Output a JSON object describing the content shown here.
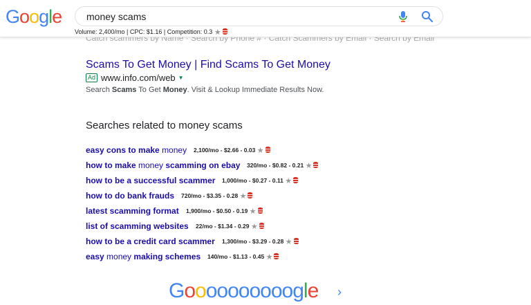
{
  "logo": {
    "letters": [
      {
        "ch": "G",
        "color": "#4285f4"
      },
      {
        "ch": "o",
        "color": "#ea4335"
      },
      {
        "ch": "o",
        "color": "#fbbc05"
      },
      {
        "ch": "g",
        "color": "#4285f4"
      },
      {
        "ch": "l",
        "color": "#34a853"
      },
      {
        "ch": "e",
        "color": "#ea4335"
      }
    ]
  },
  "search": {
    "query": "money scams"
  },
  "keyword_bar": {
    "text": "Volume: 2,400/mo | CPC: $1.16 | Competition: 0.3"
  },
  "cutoff_text": "Catch scammers by Name · Search by Phone # · Catch Scammers by Email · Search by Email",
  "ad": {
    "title": "Scams To Get Money | Find Scams To Get Money",
    "badge": "Ad",
    "url": "www.info.com/web",
    "desc_parts": [
      {
        "t": "Search ",
        "b": false
      },
      {
        "t": "Scams",
        "b": true
      },
      {
        "t": " To Get ",
        "b": false
      },
      {
        "t": "Money",
        "b": true
      },
      {
        "t": ". Visit & Lookup Immediate Results Now.",
        "b": false
      }
    ]
  },
  "related": {
    "heading": "Searches related to money scams",
    "items": [
      {
        "parts": [
          {
            "t": "easy cons to make ",
            "n": false
          },
          {
            "t": "money",
            "n": true
          }
        ],
        "metrics": "2,100/mo - $2.66 - 0.03"
      },
      {
        "parts": [
          {
            "t": "how to make ",
            "n": false
          },
          {
            "t": "money",
            "n": true
          },
          {
            "t": " scamming on ebay",
            "n": false
          }
        ],
        "metrics": "320/mo - $0.82 - 0.21"
      },
      {
        "parts": [
          {
            "t": "how to be a successful scammer",
            "n": false
          }
        ],
        "metrics": "1,000/mo - $0.27 - 0.11"
      },
      {
        "parts": [
          {
            "t": "how to do bank frauds",
            "n": false
          }
        ],
        "metrics": "720/mo - $3.35 - 0.28"
      },
      {
        "parts": [
          {
            "t": "latest scamming format",
            "n": false
          }
        ],
        "metrics": "1,900/mo - $0.50 - 0.19"
      },
      {
        "parts": [
          {
            "t": "list of scamming websites",
            "n": false
          }
        ],
        "metrics": "22/mo - $1.34 - 0.29"
      },
      {
        "parts": [
          {
            "t": "how to be a credit card scammer",
            "n": false
          }
        ],
        "metrics": "1,300/mo - $3.29 - 0.28"
      },
      {
        "parts": [
          {
            "t": "easy ",
            "n": false
          },
          {
            "t": "money",
            "n": true
          },
          {
            "t": " making schemes",
            "n": false
          }
        ],
        "metrics": "140/mo - $1.13 - 0.45"
      }
    ]
  },
  "pager": {
    "letters": [
      {
        "ch": "G",
        "color": "#4285f4"
      },
      {
        "ch": "o",
        "color": "#ea4335"
      },
      {
        "ch": "o",
        "color": "#fbbc05"
      },
      {
        "ch": "o",
        "color": "#4285f4"
      },
      {
        "ch": "o",
        "color": "#4285f4"
      },
      {
        "ch": "o",
        "color": "#4285f4"
      },
      {
        "ch": "o",
        "color": "#4285f4"
      },
      {
        "ch": "o",
        "color": "#4285f4"
      },
      {
        "ch": "o",
        "color": "#4285f4"
      },
      {
        "ch": "o",
        "color": "#4285f4"
      },
      {
        "ch": "o",
        "color": "#4285f4"
      },
      {
        "ch": "g",
        "color": "#4285f4"
      },
      {
        "ch": "l",
        "color": "#34a853"
      },
      {
        "ch": "e",
        "color": "#ea4335"
      }
    ],
    "next": "›"
  },
  "icons": {
    "mic": "microphone-icon",
    "search": "magnifier-icon",
    "star": "star-icon",
    "db": "database-icon"
  }
}
